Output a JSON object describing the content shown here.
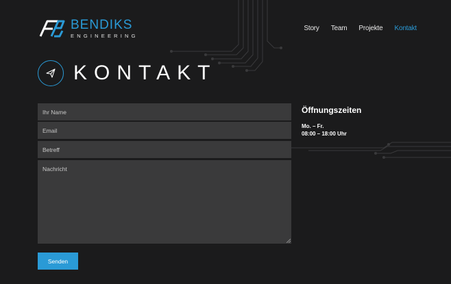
{
  "brand": {
    "name": "BENDIKS",
    "subtitle": "ENGINEERING",
    "accent_color": "#2a9ad6"
  },
  "nav": {
    "items": [
      {
        "label": "Story",
        "active": false
      },
      {
        "label": "Team",
        "active": false
      },
      {
        "label": "Projekte",
        "active": false
      },
      {
        "label": "Kontakt",
        "active": true
      }
    ]
  },
  "page": {
    "title": "KONTAKT",
    "icon": "paper-plane-icon"
  },
  "form": {
    "name_placeholder": "Ihr Name",
    "email_placeholder": "Email",
    "subject_placeholder": "Betreff",
    "message_placeholder": "Nachricht",
    "submit_label": "Senden"
  },
  "hours": {
    "title": "Öffnungszeiten",
    "days": "Mo. – Fr.",
    "time": "08:00 – 18:00 Uhr"
  }
}
